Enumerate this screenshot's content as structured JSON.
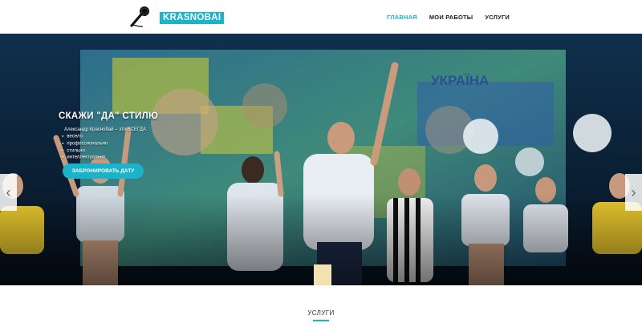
{
  "brand": {
    "name": "KRASNOBAI",
    "accent_color": "#1ab3c9",
    "logo_icon": "microphone-icon"
  },
  "nav": {
    "items": [
      {
        "label": "ГЛАВНАЯ",
        "active": true
      },
      {
        "label": "МОИ РАБОТЫ",
        "active": false
      },
      {
        "label": "УСЛУГИ",
        "active": false
      }
    ]
  },
  "hero": {
    "title": "СКАЖИ \"ДА\" СТИЛЮ",
    "intro": "Александр Краснобай – это ВСЕГДА :",
    "list": [
      "весело",
      "профессионально",
      "стильно",
      "интеллектуально"
    ],
    "cta_label": "ЗАБРОНИРОВАТЬ ДАТУ",
    "screen_text": "УКРАЇНА",
    "prev_icon": "chevron-left-icon",
    "next_icon": "chevron-right-icon",
    "slide_count": 3,
    "active_slide": 0
  },
  "services": {
    "title": "УСЛУГИ"
  }
}
